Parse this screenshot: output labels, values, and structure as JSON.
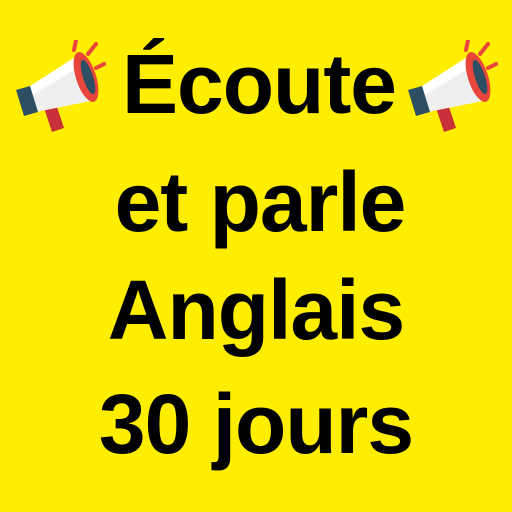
{
  "background_color": "#FFEE00",
  "text_color": "#000000",
  "headline": {
    "line1": "Écoute",
    "line2": "et parle",
    "line3": "Anglais",
    "line4": "30 jours"
  },
  "icons": {
    "left": "megaphone-icon",
    "right": "megaphone-icon"
  }
}
